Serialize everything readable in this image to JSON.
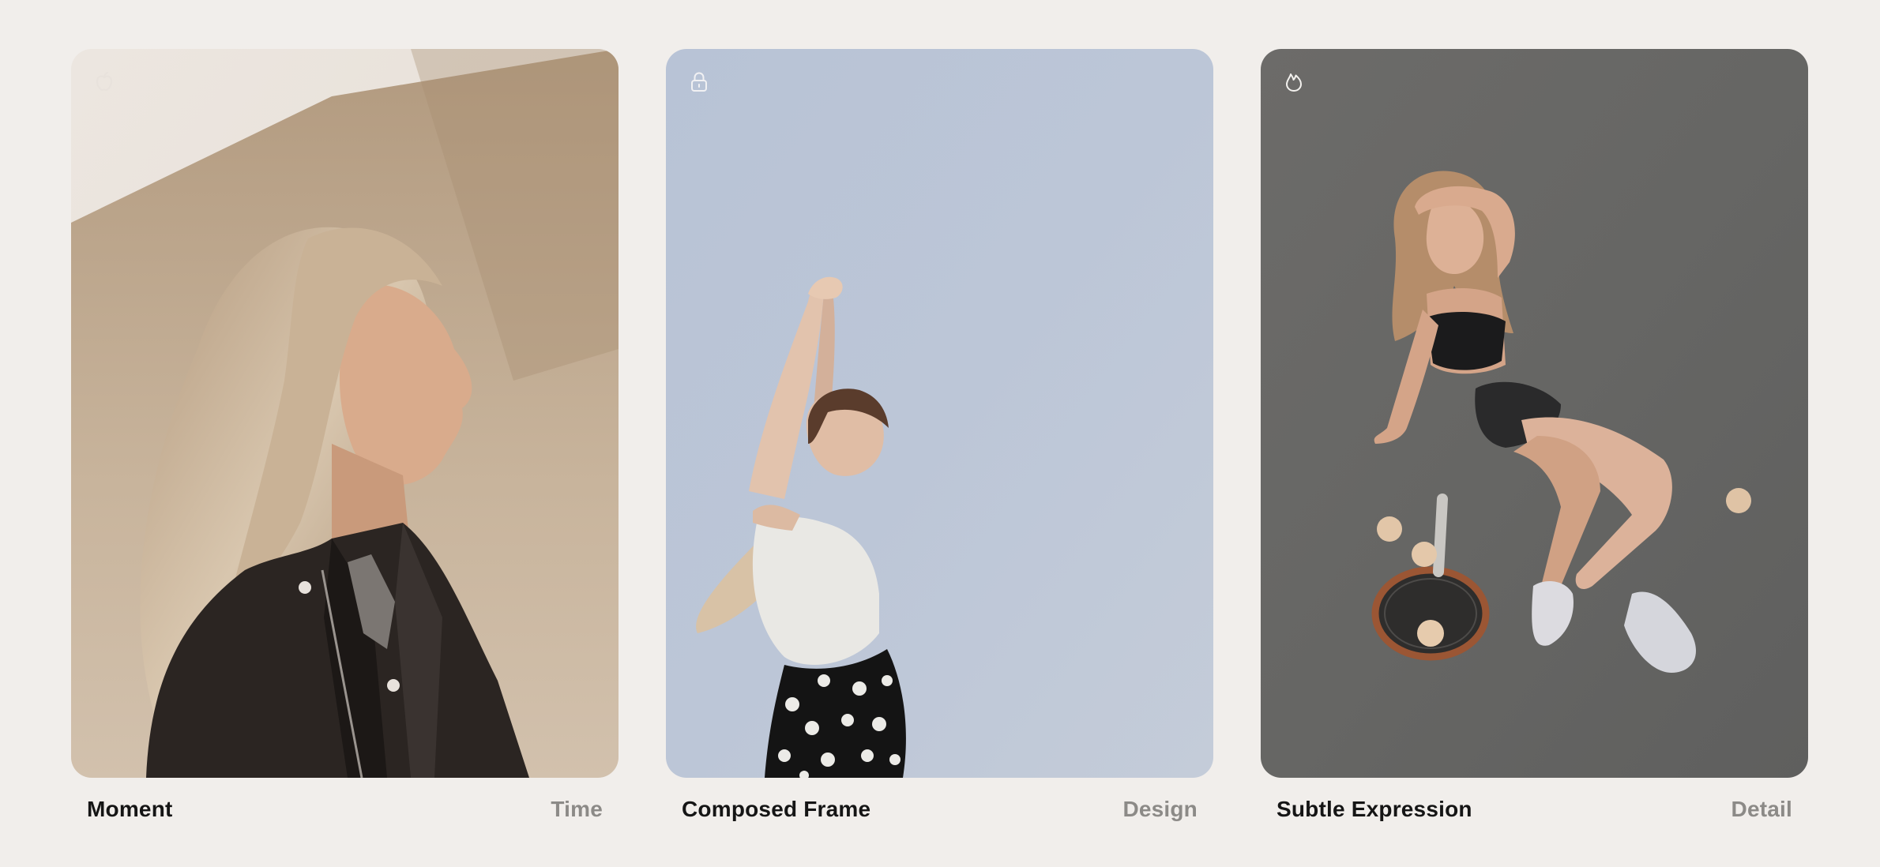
{
  "cards": [
    {
      "title": "Moment",
      "tag": "Time",
      "icon": "apple-icon",
      "photo": "woman-leather-jacket-profile"
    },
    {
      "title": "Composed Frame",
      "tag": "Design",
      "icon": "lock-icon",
      "photo": "woman-arms-raised-sky"
    },
    {
      "title": "Subtle Expression",
      "tag": "Detail",
      "icon": "flame-icon",
      "photo": "woman-tennis-court-racket"
    }
  ],
  "colors": {
    "background": "#f1eeeb",
    "title": "#151515",
    "tag": "#8c8a87"
  }
}
